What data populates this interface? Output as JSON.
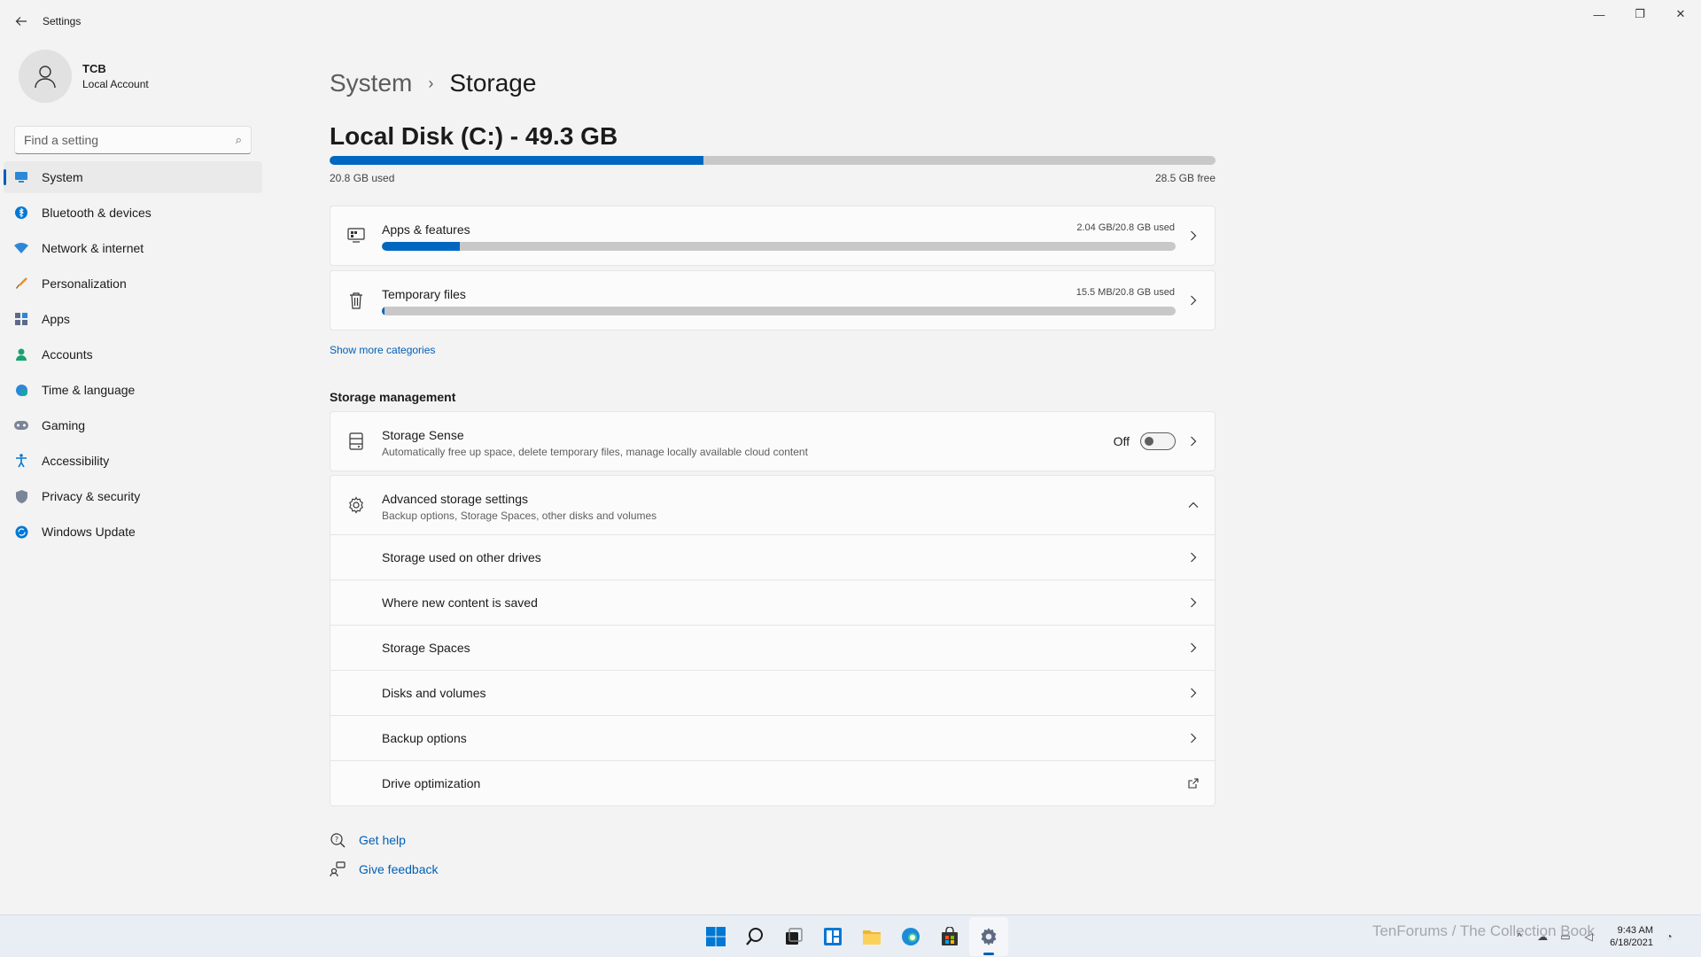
{
  "window": {
    "title": "Settings",
    "back_icon": "arrow-left-icon",
    "minimize_glyph": "—",
    "maximize_glyph": "❐",
    "close_glyph": "✕"
  },
  "profile": {
    "name": "TCB",
    "account_type": "Local Account"
  },
  "search": {
    "placeholder": "Find a setting",
    "value": ""
  },
  "nav": {
    "items": [
      {
        "label": "System",
        "icon": "monitor-icon",
        "active": true
      },
      {
        "label": "Bluetooth & devices",
        "icon": "bluetooth-icon"
      },
      {
        "label": "Network & internet",
        "icon": "wifi-icon"
      },
      {
        "label": "Personalization",
        "icon": "brush-icon"
      },
      {
        "label": "Apps",
        "icon": "apps-icon"
      },
      {
        "label": "Accounts",
        "icon": "person-icon"
      },
      {
        "label": "Time & language",
        "icon": "globe-clock-icon"
      },
      {
        "label": "Gaming",
        "icon": "gamepad-icon"
      },
      {
        "label": "Accessibility",
        "icon": "accessibility-icon"
      },
      {
        "label": "Privacy & security",
        "icon": "shield-icon"
      },
      {
        "label": "Windows Update",
        "icon": "update-icon"
      }
    ]
  },
  "breadcrumb": {
    "parent": "System",
    "separator": "›",
    "current": "Storage"
  },
  "disk": {
    "title": "Local Disk (C:) - 49.3 GB",
    "used_label": "20.8 GB used",
    "free_label": "28.5 GB free",
    "used_fraction": 0.422
  },
  "categories": [
    {
      "title": "Apps & features",
      "value": "2.04 GB/20.8 GB used",
      "fraction": 0.098,
      "icon": "apps-features-icon"
    },
    {
      "title": "Temporary files",
      "value": "15.5 MB/20.8 GB used",
      "fraction": 0.001,
      "icon": "trash-icon"
    }
  ],
  "show_more": "Show more categories",
  "storage_management": {
    "header": "Storage management",
    "storage_sense": {
      "title": "Storage Sense",
      "subtitle": "Automatically free up space, delete temporary files, manage locally available cloud content",
      "toggle_label": "Off",
      "toggle_on": false,
      "icon": "storage-sense-icon"
    },
    "advanced": {
      "title": "Advanced storage settings",
      "subtitle": "Backup options, Storage Spaces, other disks and volumes",
      "icon": "gear-icon",
      "expanded": true,
      "items": [
        {
          "label": "Storage used on other drives",
          "icon": "chevron-right-icon"
        },
        {
          "label": "Where new content is saved",
          "icon": "chevron-right-icon"
        },
        {
          "label": "Storage Spaces",
          "icon": "chevron-right-icon"
        },
        {
          "label": "Disks and volumes",
          "icon": "chevron-right-icon"
        },
        {
          "label": "Backup options",
          "icon": "chevron-right-icon"
        },
        {
          "label": "Drive optimization",
          "icon": "external-link-icon"
        }
      ]
    }
  },
  "help": {
    "get_help": "Get help",
    "give_feedback": "Give feedback"
  },
  "taskbar": {
    "apps": [
      "start-icon",
      "search-icon",
      "task-view-icon",
      "widgets-icon",
      "file-explorer-icon",
      "edge-icon",
      "store-icon",
      "settings-icon"
    ],
    "active": "settings-icon",
    "watermark": "TenForums / The Collection Book",
    "time": "9:43 AM",
    "date": "6/18/2021"
  },
  "colors": {
    "accent": "#0067c0",
    "link": "#005fb8",
    "bar_track": "#c8c8c8"
  }
}
